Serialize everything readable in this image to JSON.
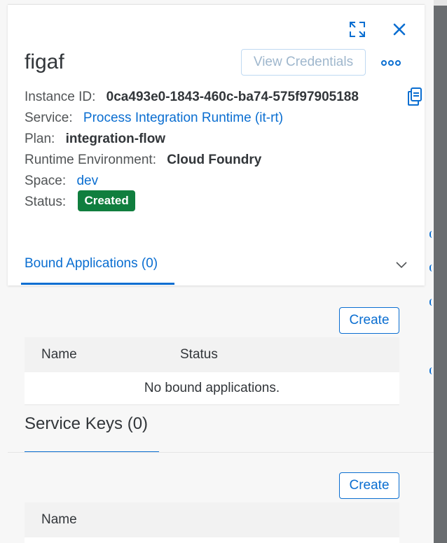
{
  "header": {
    "title": "figaf",
    "view_credentials_label": "View Credentials",
    "expand_icon": "expand-icon",
    "close_icon": "close-icon",
    "more_icon": "more-icon"
  },
  "details": {
    "instance_id_label": "Instance ID:",
    "instance_id": "0ca493e0-1843-460c-ba74-575f97905188",
    "service_label": "Service:",
    "service": "Process Integration Runtime (it-rt)",
    "plan_label": "Plan:",
    "plan": "integration-flow",
    "runtime_label": "Runtime Environment:",
    "runtime": "Cloud Foundry",
    "space_label": "Space:",
    "space": "dev",
    "status_label": "Status:",
    "status": "Created"
  },
  "bound_apps": {
    "tab_label": "Bound Applications (0)",
    "create_label": "Create",
    "columns": [
      "Name",
      "Status"
    ],
    "empty_text": "No bound applications."
  },
  "service_keys": {
    "title": "Service Keys (0)",
    "create_label": "Create",
    "columns": [
      "Name"
    ]
  },
  "colors": {
    "accent": "#0a6ed1",
    "status_success": "#107e3e"
  }
}
